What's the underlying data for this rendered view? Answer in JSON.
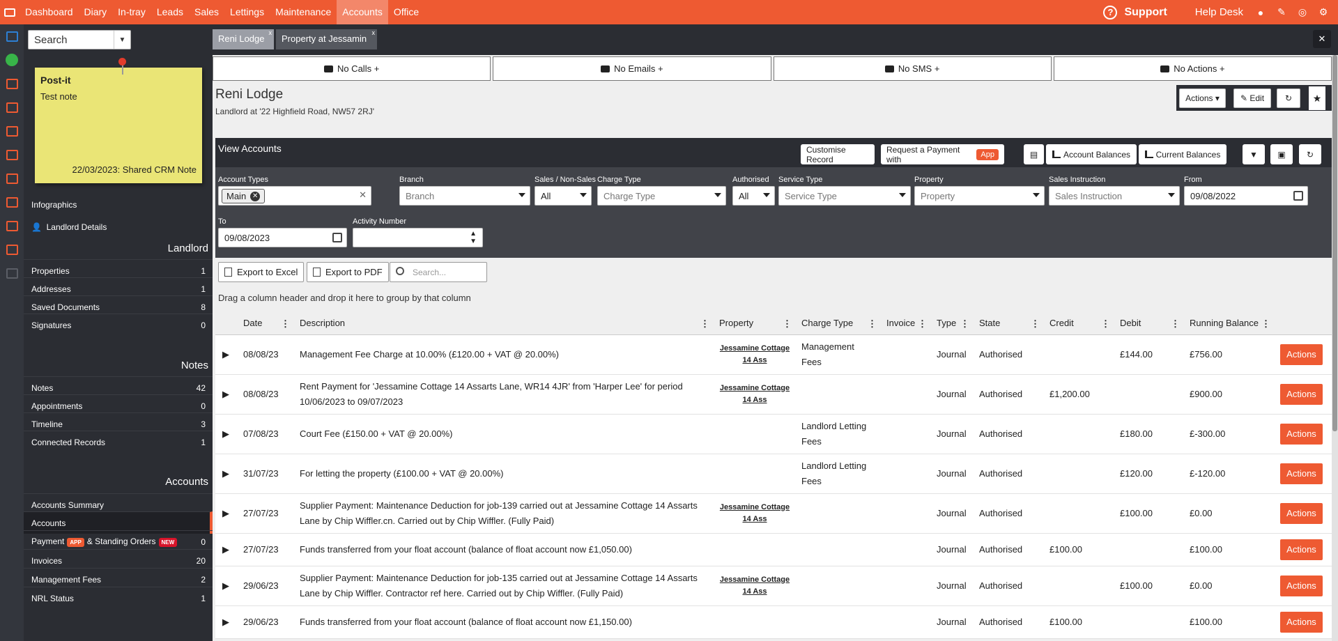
{
  "topnav": {
    "items": [
      "Dashboard",
      "Diary",
      "In-tray",
      "Leads",
      "Sales",
      "Lettings",
      "Maintenance",
      "Accounts",
      "Office"
    ],
    "active": "Accounts",
    "support": "Support",
    "helpdesk": "Help Desk"
  },
  "search": {
    "value": "Search"
  },
  "record_tabs": [
    {
      "label": "Reni Lodge",
      "active": true
    },
    {
      "label": "Property at Jessamin",
      "active": false
    }
  ],
  "postit": {
    "title": "Post-it",
    "text": "Test note",
    "footer": "22/03/2023: Shared CRM Note"
  },
  "sidebar": {
    "infographics": "Infographics",
    "landlord_details": "Landlord Details",
    "sections": {
      "landlord": "Landlord",
      "notes": "Notes",
      "accounts": "Accounts"
    },
    "landlord_items": [
      {
        "label": "Properties",
        "count": "1"
      },
      {
        "label": "Addresses",
        "count": "1"
      },
      {
        "label": "Saved Documents",
        "count": "8"
      },
      {
        "label": "Signatures",
        "count": "0"
      }
    ],
    "notes_items": [
      {
        "label": "Notes",
        "count": "42"
      },
      {
        "label": "Appointments",
        "count": "0"
      },
      {
        "label": "Timeline",
        "count": "3"
      },
      {
        "label": "Connected Records",
        "count": "1"
      }
    ],
    "accounts_items": [
      {
        "label": "Accounts Summary",
        "count": ""
      },
      {
        "label": "Accounts",
        "count": ""
      },
      {
        "label": "Payment",
        "badge1": "APP",
        "label2": "& Standing Orders",
        "badge2": "NEW",
        "count": "0"
      },
      {
        "label": "Invoices",
        "count": "20"
      },
      {
        "label": "Management Fees",
        "count": "2"
      },
      {
        "label": "NRL Status",
        "count": "1"
      }
    ]
  },
  "comm": {
    "calls": "No Calls +",
    "emails": "No Emails +",
    "sms": "No SMS +",
    "actions": "No Actions +"
  },
  "record": {
    "title": "Reni Lodge",
    "subtitle": "Landlord at '22 Highfield Road, NW57 2RJ'",
    "actions_label": "Actions ▾",
    "edit_label": "Edit"
  },
  "panel": {
    "title": "View Accounts",
    "customise": "Customise Record",
    "request_payment": "Request a Payment with",
    "app_tag": "App",
    "account_balances": "Account Balances",
    "current_balances": "Current Balances"
  },
  "filters": {
    "account_types": {
      "label": "Account Types",
      "chip": "Main"
    },
    "branch": {
      "label": "Branch",
      "placeholder": "Branch"
    },
    "sales": {
      "label": "Sales / Non-Sales",
      "value": "All"
    },
    "charge_type": {
      "label": "Charge Type",
      "placeholder": "Charge Type"
    },
    "authorised": {
      "label": "Authorised",
      "value": "All"
    },
    "service_type": {
      "label": "Service Type",
      "placeholder": "Service Type"
    },
    "property": {
      "label": "Property",
      "placeholder": "Property"
    },
    "sales_instruction": {
      "label": "Sales Instruction",
      "placeholder": "Sales Instruction"
    },
    "from": {
      "label": "From",
      "value": "09/08/2022"
    },
    "to": {
      "label": "To",
      "value": "09/08/2023"
    },
    "activity": {
      "label": "Activity Number",
      "value": ""
    }
  },
  "toolbar": {
    "export_excel": "Export to Excel",
    "export_pdf": "Export to PDF",
    "search_placeholder": "Search...",
    "drag_hint": "Drag a column header and drop it here to group by that column"
  },
  "grid": {
    "columns": [
      "Date",
      "Description",
      "Property",
      "Charge Type",
      "Invoice",
      "Type",
      "State",
      "Credit",
      "Debit",
      "Running Balance"
    ],
    "action_label": "Actions",
    "rows": [
      {
        "date": "08/08/23",
        "description": "Management Fee Charge at 10.00% (£120.00 + VAT @ 20.00%)",
        "property": "Jessamine Cottage 14 Ass",
        "charge": "Management Fees",
        "invoice": "",
        "type": "Journal",
        "state": "Authorised",
        "credit": "",
        "debit": "£144.00",
        "balance": "£756.00"
      },
      {
        "date": "08/08/23",
        "description": "Rent Payment for 'Jessamine Cottage 14 Assarts Lane, WR14 4JR' from 'Harper Lee' for period 10/06/2023 to 09/07/2023",
        "property": "Jessamine Cottage 14 Ass",
        "charge": "",
        "invoice": "",
        "type": "Journal",
        "state": "Authorised",
        "credit": "£1,200.00",
        "debit": "",
        "balance": "£900.00"
      },
      {
        "date": "07/08/23",
        "description": "Court Fee (£150.00 + VAT @ 20.00%)",
        "property": "",
        "charge": "Landlord Letting Fees",
        "invoice": "",
        "type": "Journal",
        "state": "Authorised",
        "credit": "",
        "debit": "£180.00",
        "balance": "£-300.00"
      },
      {
        "date": "31/07/23",
        "description": "For letting the property (£100.00 + VAT @ 20.00%)",
        "property": "",
        "charge": "Landlord Letting Fees",
        "invoice": "",
        "type": "Journal",
        "state": "Authorised",
        "credit": "",
        "debit": "£120.00",
        "balance": "£-120.00"
      },
      {
        "date": "27/07/23",
        "description": "Supplier Payment: Maintenance Deduction for job-139 carried out at Jessamine Cottage 14 Assarts Lane by Chip Wiffler.cn. Carried out by Chip Wiffler. (Fully Paid)",
        "property": "Jessamine Cottage 14 Ass",
        "charge": "",
        "invoice": "",
        "type": "Journal",
        "state": "Authorised",
        "credit": "",
        "debit": "£100.00",
        "balance": "£0.00"
      },
      {
        "date": "27/07/23",
        "description": "Funds transferred from your float account (balance of float account now £1,050.00)",
        "property": "",
        "charge": "",
        "invoice": "",
        "type": "Journal",
        "state": "Authorised",
        "credit": "£100.00",
        "debit": "",
        "balance": "£100.00"
      },
      {
        "date": "29/06/23",
        "description": "Supplier Payment: Maintenance Deduction for job-135 carried out at Jessamine Cottage 14 Assarts Lane by Chip Wiffler. Contractor ref here. Carried out by Chip Wiffler. (Fully Paid)",
        "property": "Jessamine Cottage 14 Ass",
        "charge": "",
        "invoice": "",
        "type": "Journal",
        "state": "Authorised",
        "credit": "",
        "debit": "£100.00",
        "balance": "£0.00"
      },
      {
        "date": "29/06/23",
        "description": "Funds transferred from your float account (balance of float account now £1,150.00)",
        "property": "",
        "charge": "",
        "invoice": "",
        "type": "Journal",
        "state": "Authorised",
        "credit": "£100.00",
        "debit": "",
        "balance": "£100.00"
      }
    ]
  },
  "colors": {
    "accent": "#ee5a32",
    "dark": "#2b2d33",
    "new_badge": "#d8142a"
  }
}
